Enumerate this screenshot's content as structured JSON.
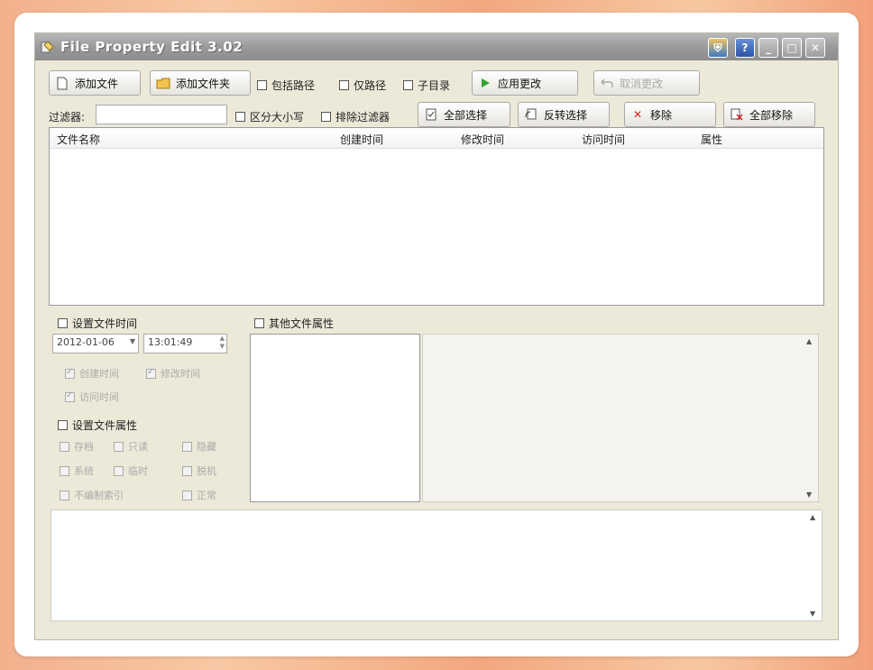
{
  "window": {
    "title": "File Property Edit 3.02"
  },
  "toolbar": {
    "add_file": "添加文件",
    "add_folder": "添加文件夹",
    "include_path": "包括路径",
    "path_only": "仅路径",
    "subdir": "子目录",
    "apply": "应用更改",
    "cancel": "取消更改"
  },
  "filter": {
    "label": "过滤器:",
    "value": "",
    "case_sensitive": "区分大小写",
    "exclude": "排除过滤器",
    "select_all": "全部选择",
    "invert": "反转选择",
    "remove": "移除",
    "remove_all": "全部移除"
  },
  "list": {
    "columns": [
      "文件名称",
      "创建时间",
      "修改时间",
      "访问时间",
      "属性"
    ]
  },
  "time_panel": {
    "label": "设置文件时间",
    "date": "2012-01-06",
    "time": "13:01:49",
    "created": "创建时间",
    "modified": "修改时间",
    "accessed": "访问时间"
  },
  "attr_panel": {
    "label": "设置文件属性",
    "archive": "存档",
    "readonly": "只读",
    "hidden": "隐藏",
    "system": "系统",
    "temporary": "临时",
    "offline": "脱机",
    "not_indexed": "不编制索引",
    "normal": "正常"
  },
  "other_panel": {
    "label": "其他文件属性"
  },
  "colors": {
    "title_bar": "#9a9a9a",
    "window_bg": "#ece9d8",
    "apply_icon": "#2fa82f",
    "remove_icon": "#d22222"
  }
}
